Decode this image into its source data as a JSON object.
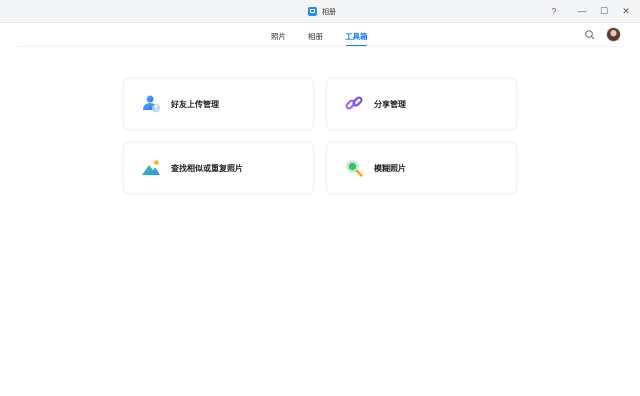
{
  "window": {
    "title": "相册",
    "help_label": "?",
    "min_label": "—",
    "max_label": "☐",
    "close_label": "✕"
  },
  "nav": {
    "tabs": [
      {
        "label": "照片"
      },
      {
        "label": "相册"
      },
      {
        "label": "工具箱"
      }
    ],
    "active_tab": "工具箱"
  },
  "tools": {
    "friend_upload": "好友上传管理",
    "share_manage": "分享管理",
    "find_similar": "查找相似或重复照片",
    "blurry_photos": "模糊照片"
  },
  "colors": {
    "accent": "#1677ff",
    "share_purple": "#8b5cf6",
    "blurry_green": "#22c55e"
  },
  "icons": [
    "friend-upload-icon",
    "link-icon",
    "landscape-icon",
    "magnifier-icon",
    "search-icon"
  ]
}
